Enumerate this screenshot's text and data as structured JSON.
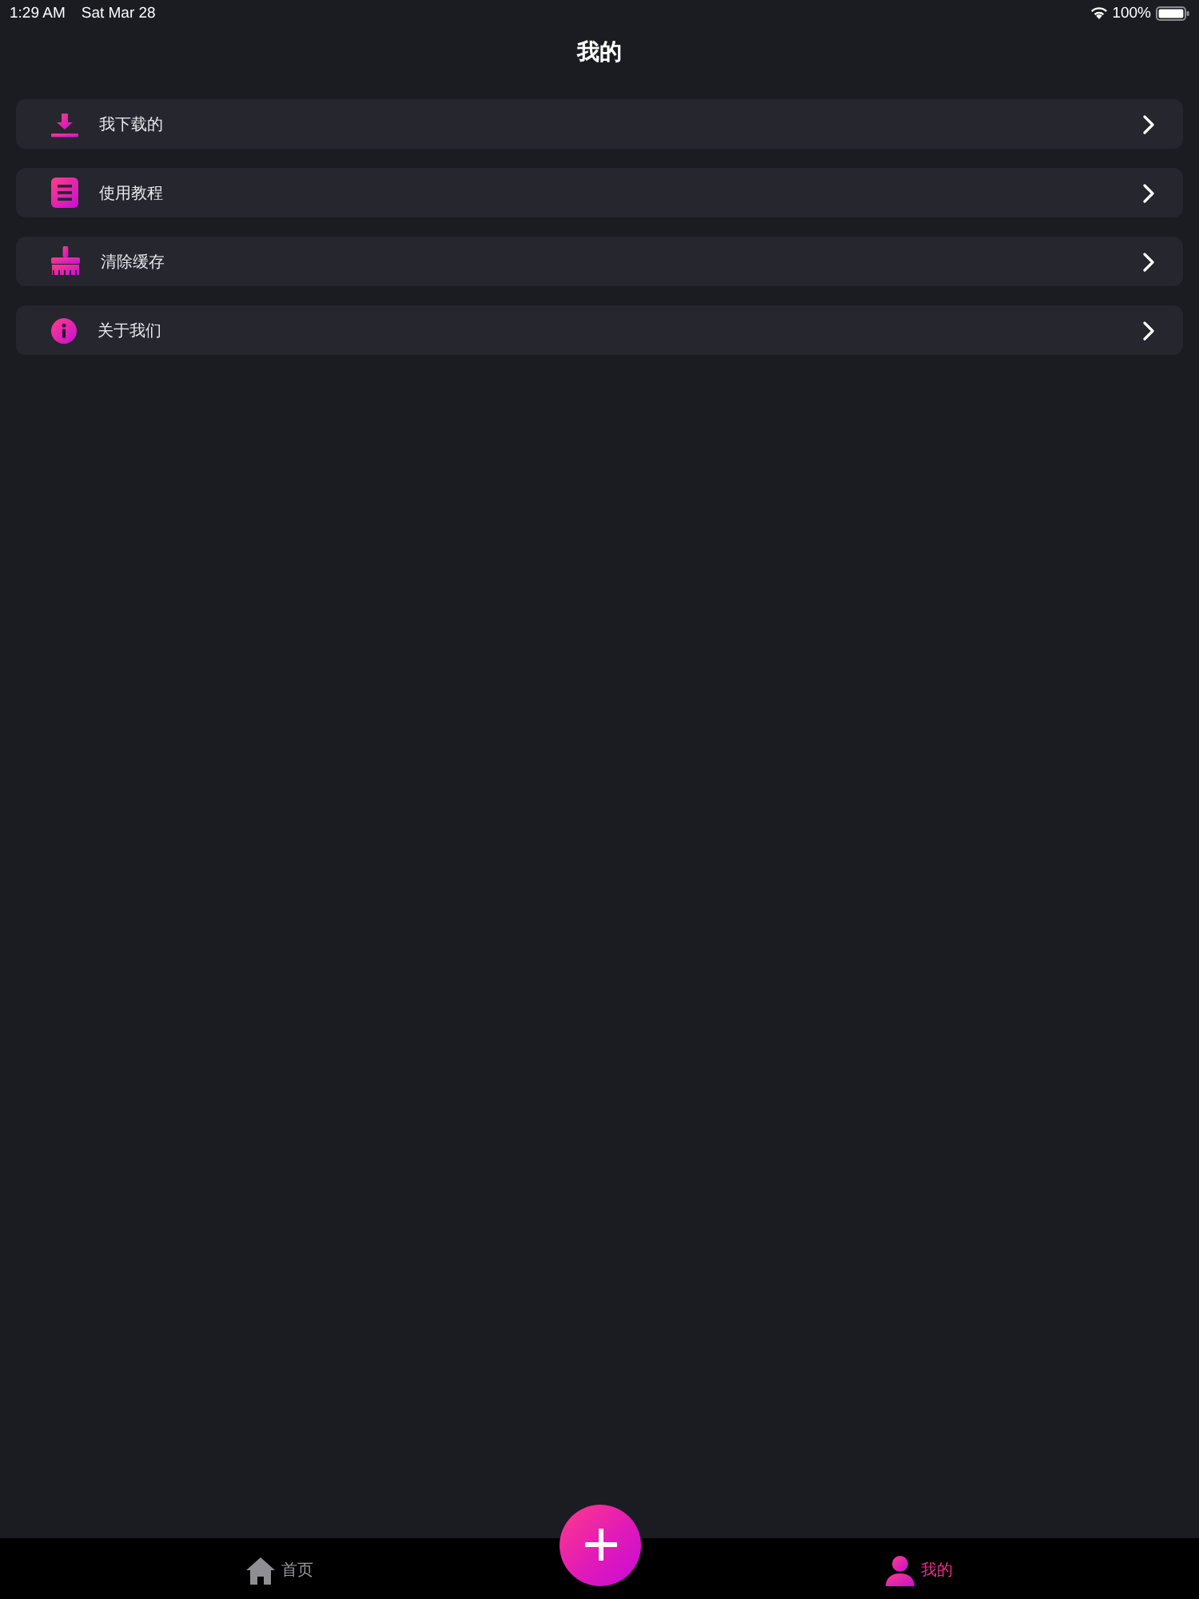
{
  "status_bar": {
    "time": "1:29 AM",
    "date": "Sat Mar 28",
    "battery": "100%"
  },
  "header": {
    "title": "我的"
  },
  "menu": [
    {
      "kind": "download",
      "label": "我下载的"
    },
    {
      "kind": "tutorial",
      "label": "使用教程"
    },
    {
      "kind": "clear_cache",
      "label": "清除缓存"
    },
    {
      "kind": "about",
      "label": "关于我们"
    }
  ],
  "tab_bar": {
    "tabs": [
      {
        "kind": "home",
        "label": "首页",
        "selected": false
      },
      {
        "kind": "profile",
        "label": "我的",
        "selected": true
      }
    ]
  }
}
